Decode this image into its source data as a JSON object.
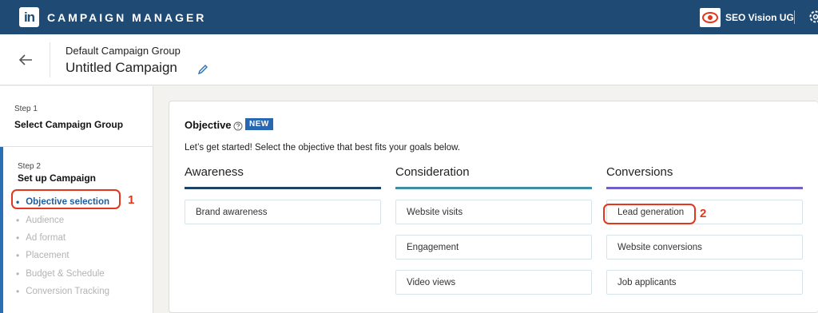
{
  "topbar": {
    "logo_text": "in",
    "app_title": "CAMPAIGN MANAGER",
    "account_name": "SEO Vision UG",
    "colors": {
      "bar": "#1e4a74"
    }
  },
  "campaign": {
    "group_name": "Default Campaign Group",
    "name": "Untitled Campaign"
  },
  "sidebar": {
    "step1": {
      "label": "Step 1",
      "title": "Select Campaign Group"
    },
    "step2": {
      "label": "Step 2",
      "title": "Set up Campaign",
      "substeps": [
        {
          "label": "Objective selection",
          "active": true
        },
        {
          "label": "Audience",
          "active": false
        },
        {
          "label": "Ad format",
          "active": false
        },
        {
          "label": "Placement",
          "active": false
        },
        {
          "label": "Budget & Schedule",
          "active": false
        },
        {
          "label": "Conversion Tracking",
          "active": false
        }
      ]
    },
    "annotation_1": "1"
  },
  "objective": {
    "title": "Objective",
    "badge": "NEW",
    "intro": "Let’s get started! Select the objective that best fits your goals below.",
    "columns": [
      {
        "heading": "Awareness",
        "options": [
          "Brand awareness"
        ]
      },
      {
        "heading": "Consideration",
        "options": [
          "Website visits",
          "Engagement",
          "Video views"
        ]
      },
      {
        "heading": "Conversions",
        "options": [
          "Lead generation",
          "Website conversions",
          "Job applicants"
        ]
      }
    ],
    "annotation_2": "2",
    "colors": {
      "awareness": "#1d4466",
      "consideration": "#3d8fa3",
      "conversions": "#6f5fc9",
      "highlight": "#e4361c"
    }
  }
}
